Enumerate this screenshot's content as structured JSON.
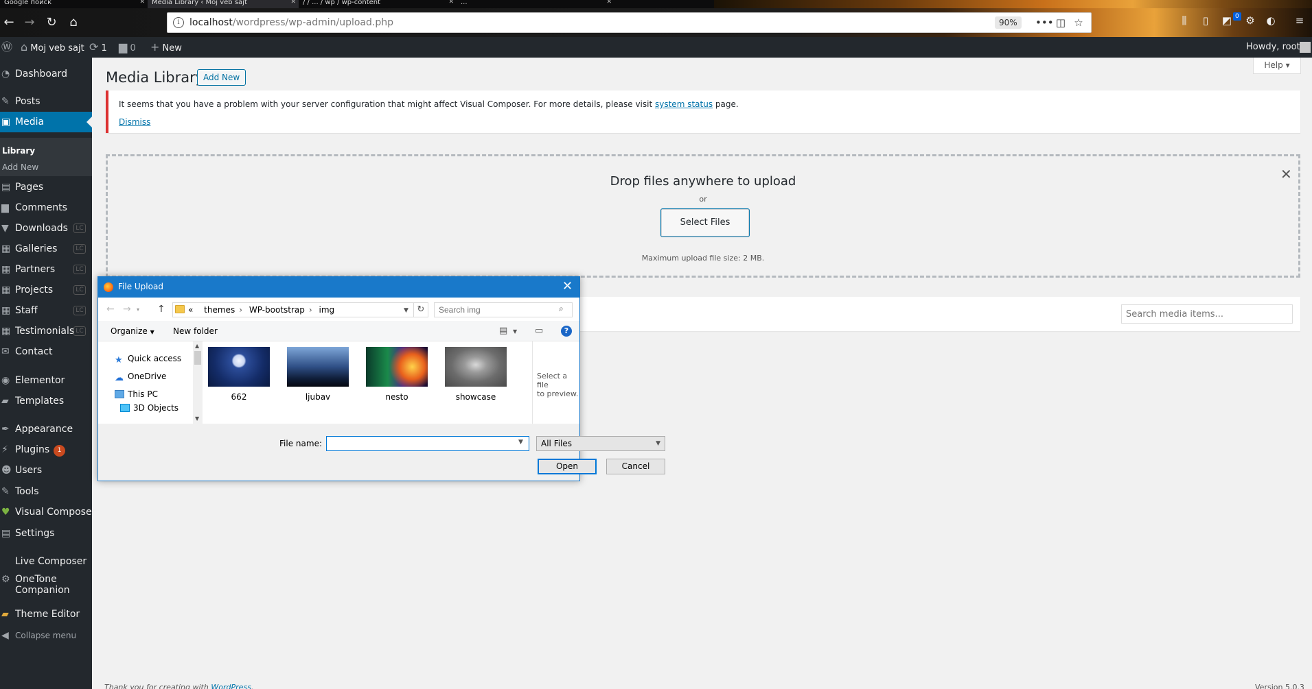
{
  "browser": {
    "tabs": [
      {
        "title": "Google поиск",
        "active": false
      },
      {
        "title": "Media Library ‹ Moj veb sajt",
        "active": true
      },
      {
        "title": "/ / ... / wp / wp-content",
        "active": false
      },
      {
        "title": "...",
        "active": false
      }
    ],
    "url_host": "localhost",
    "url_path": "/wordpress/wp-admin/upload.php",
    "zoom": "90%",
    "extension_badge": "0"
  },
  "admin_bar": {
    "site_name": "Moj veb sajt",
    "updates_count": "1",
    "comments_count": "0",
    "new_label": "New",
    "howdy": "Howdy, root"
  },
  "sidebar": {
    "dashboard": "Dashboard",
    "posts": "Posts",
    "media": "Media",
    "library": "Library",
    "add_new": "Add New",
    "pages": "Pages",
    "comments": "Comments",
    "downloads": "Downloads",
    "galleries": "Galleries",
    "partners": "Partners",
    "projects": "Projects",
    "staff": "Staff",
    "testimonials": "Testimonials",
    "contact": "Contact",
    "elementor": "Elementor",
    "templates": "Templates",
    "appearance": "Appearance",
    "plugins": "Plugins",
    "plugins_badge": "1",
    "users": "Users",
    "tools": "Tools",
    "visual_composer": "Visual Composer",
    "settings": "Settings",
    "live_composer": "Live Composer",
    "onetone_line1": "OneTone",
    "onetone_line2": "Companion",
    "theme_editor": "Theme Editor",
    "collapse": "Collapse menu",
    "lc_badge": "LC"
  },
  "main": {
    "title": "Media Library",
    "add_new": "Add New",
    "help": "Help",
    "notice_text": "It seems that you have a problem with your server configuration that might affect Visual Composer. For more details, please visit",
    "notice_link": "system status",
    "notice_suffix": "page.",
    "dismiss": "Dismiss",
    "drop_text": "Drop files anywhere to upload",
    "or_text": "or",
    "select_files": "Select Files",
    "max_size": "Maximum upload file size: 2 MB.",
    "search_placeholder": "Search media items..."
  },
  "footer": {
    "thanks_prefix": "Thank you for creating with",
    "thanks_link": "WordPress",
    "version": "Version 5.0.3"
  },
  "dialog": {
    "title": "File Upload",
    "breadcrumb": [
      "«",
      "themes",
      "WP-bootstrap",
      "img"
    ],
    "search_placeholder": "Search img",
    "organize": "Organize",
    "new_folder": "New folder",
    "nav_items": [
      "Quick access",
      "OneDrive",
      "This PC",
      "3D Objects"
    ],
    "files": [
      "662",
      "ljubav",
      "nesto",
      "showcase"
    ],
    "preview_line1": "Select a file",
    "preview_line2": "to preview.",
    "file_name_label": "File name:",
    "file_name_value": "",
    "file_type": "All Files",
    "open": "Open",
    "cancel": "Cancel"
  }
}
